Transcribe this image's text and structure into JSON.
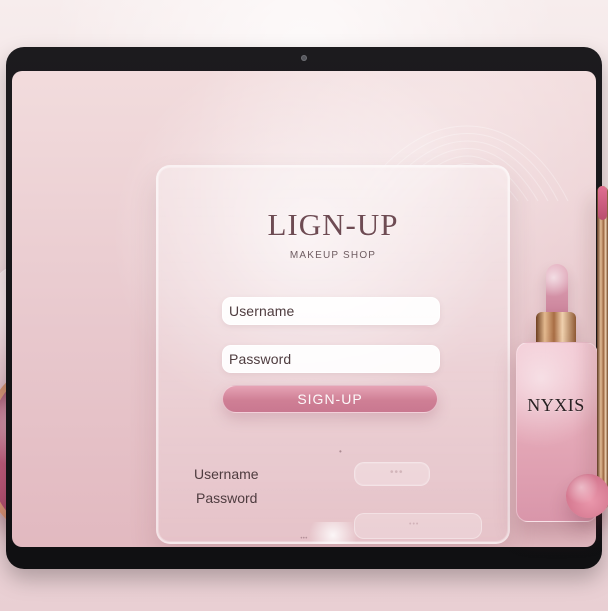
{
  "signup": {
    "title": "LIGN-UP",
    "subtitle": "MAKEUP SHOP",
    "username_label": "Username",
    "password_label": "Password",
    "signup_button": "SIGN-UP",
    "secondary_username_label": "Username",
    "secondary_password_label": "Password"
  },
  "branding": {
    "product_label": "NYXIS"
  },
  "colors": {
    "accent": "#cf7f95",
    "device": "#111113",
    "background": "#efd9dc"
  }
}
